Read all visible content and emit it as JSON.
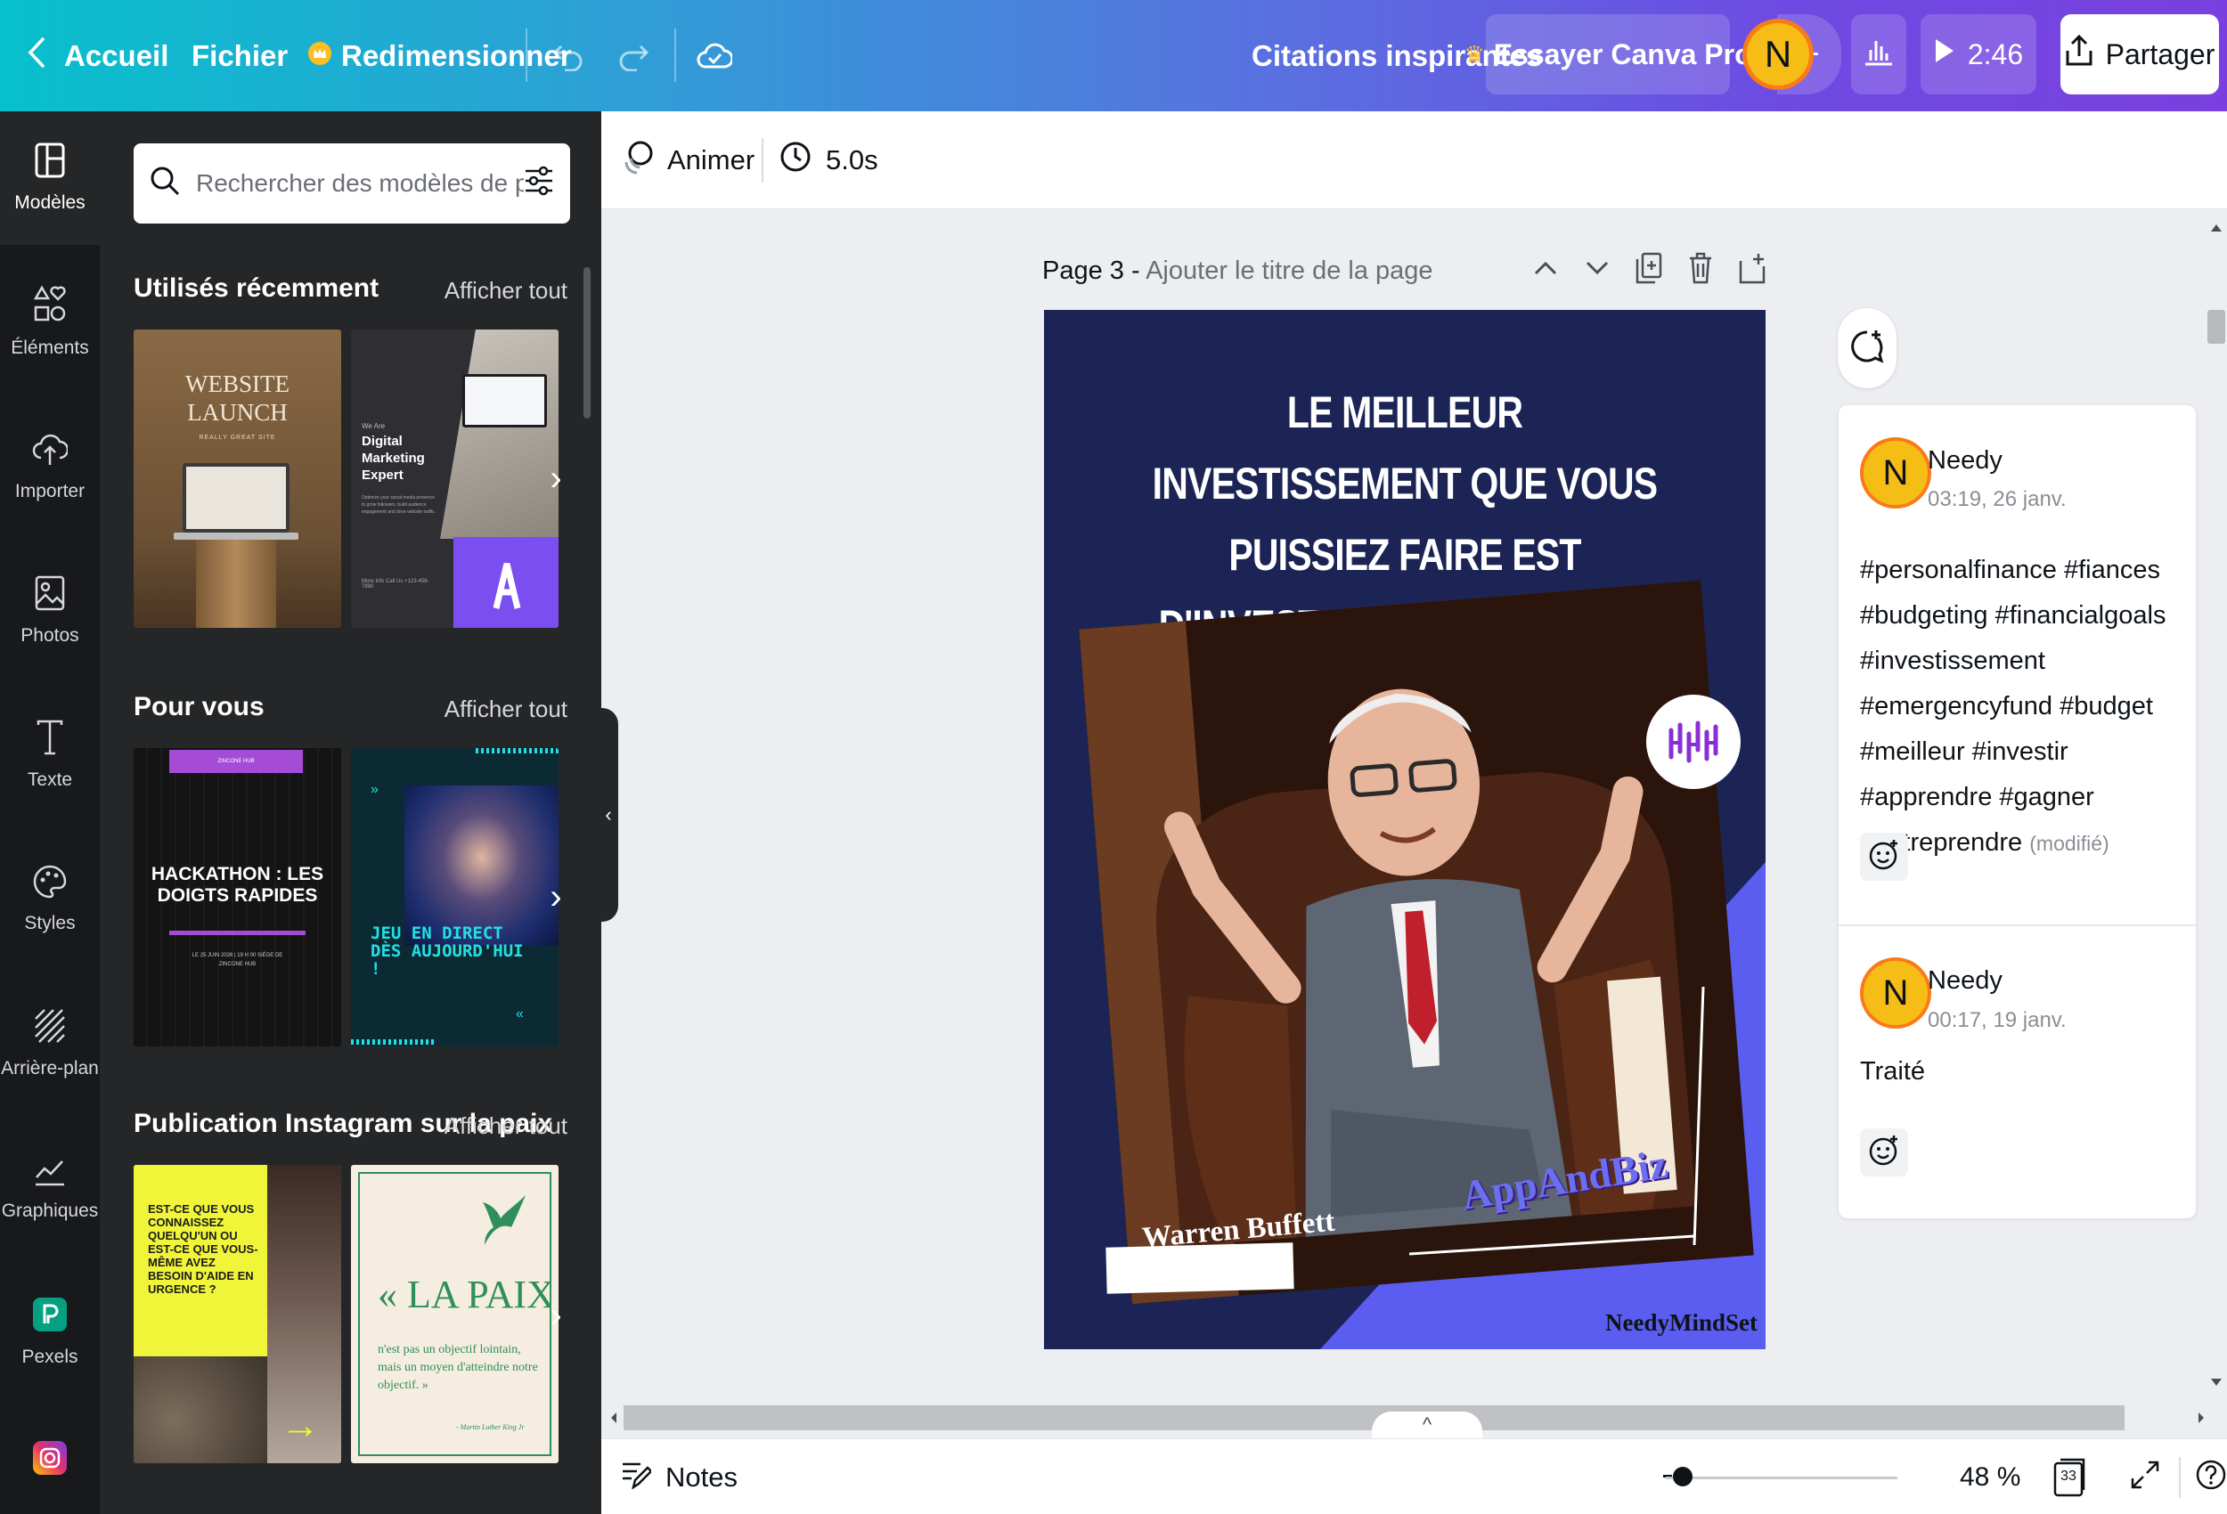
{
  "topbar": {
    "back_label": "Accueil",
    "file_label": "Fichier",
    "resize_label": "Redimensionner",
    "doc_title": "Citations inspirantes",
    "try_pro_label": "Essayer Canva Pro",
    "avatar_initial": "N",
    "timer_label": "2:46",
    "share_label": "Partager"
  },
  "rail": {
    "items": [
      {
        "label": "Modèles",
        "icon": "templates-icon"
      },
      {
        "label": "Éléments",
        "icon": "elements-icon"
      },
      {
        "label": "Importer",
        "icon": "upload-icon"
      },
      {
        "label": "Photos",
        "icon": "photos-icon"
      },
      {
        "label": "Texte",
        "icon": "text-icon"
      },
      {
        "label": "Styles",
        "icon": "palette-icon"
      },
      {
        "label": "Arrière-plan",
        "icon": "background-icon"
      },
      {
        "label": "Graphiques",
        "icon": "chart-icon"
      },
      {
        "label": "Pexels",
        "icon": "pexels-icon"
      },
      {
        "label": "",
        "icon": "instagram-icon"
      }
    ]
  },
  "panel": {
    "search_placeholder": "Rechercher des modèles de publi",
    "sections": [
      {
        "title": "Utilisés récemment",
        "link": "Afficher tout"
      },
      {
        "title": "Pour vous",
        "link": "Afficher tout"
      },
      {
        "title": "Publication Instagram sur la paix",
        "link": "Afficher tout"
      }
    ],
    "thumbs": {
      "website_launch": "WEBSITE LAUNCH",
      "website_launch_sub": "REALLY GREAT SITE",
      "marketing_we_are": "We Are",
      "marketing_title": "Digital Marketing Expert",
      "marketing_body": "Optimize your social media presence to grow followers, build audience engagement and drive website traffic.",
      "marketing_contact": "More Info Call Us +123-456-7890",
      "hackathon_tag": "ZINCONE HUB",
      "hackathon_title": "HACKATHON : LES DOIGTS RAPIDES",
      "hackathon_date": "LE 25 JUIN 2026 | 19 H 00 SIÈGE DE ZINCONE HUB",
      "live_title": "JEU EN DIRECT DÈS AUJOURD'HUI !",
      "help_title": "EST-CE QUE VOUS CONNAISSEZ QUELQU'UN OU EST-CE QUE VOUS-MÊME AVEZ BESOIN D'AIDE EN URGENCE ?",
      "peace_title": "« LA PAIX",
      "peace_body": "n'est pas un objectif lointain, mais un moyen d'atteindre notre objectif. »",
      "peace_author": "- Martin Luther King Jr"
    }
  },
  "toolbar": {
    "animate_label": "Animer",
    "duration_label": "5.0s"
  },
  "page": {
    "number_label": "Page 3 - ",
    "title_placeholder": "Ajouter le titre de la page"
  },
  "design": {
    "quote": "LE MEILLEUR INVESTISSEMENT QUE VOUS PUISSIEZ FAIRE EST D'INVESTIR EN VOUS-MÊME. PLUS VOUS APPRENEZ, PLUS VOUS GAGNEZ.",
    "person_label": "Warren Buffett",
    "brand_label": "AppAndBiz",
    "signature": "NeedyMindSet",
    "colors": {
      "background": "#1b2454",
      "accent": "#5a5df0"
    }
  },
  "comments": [
    {
      "author": "Needy",
      "initial": "N",
      "time": "03:19, 26 janv.",
      "body": "#personalfinance #fiances #budgeting #financialgoals #investissement #emergencyfund #budget #meilleur #investir #apprendre #gagner #entreprendre",
      "modified": "(modifié)"
    },
    {
      "author": "Needy",
      "initial": "N",
      "time": "00:17, 19 janv.",
      "body": "Traité",
      "modified": ""
    }
  ],
  "bottombar": {
    "notes_label": "Notes",
    "zoom_label": "48 %",
    "page_count": "33",
    "zoom_value_percent": 48
  }
}
